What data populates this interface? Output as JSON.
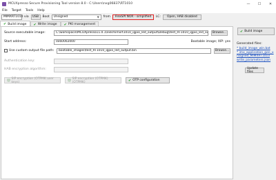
{
  "window": {
    "title": "MCUXpresso Secure Provisioning Tool version 8.0 - C:\\Users\\nxg06837\\RT1010",
    "minimize": "—",
    "maximize": "☐",
    "close": "✕"
  },
  "menu": [
    "File",
    "Target",
    "Tools",
    "Help"
  ],
  "toolbar": {
    "device": "MIMXRT1010",
    "via_label": "via",
    "via_value": "USB",
    "boot_label": "Boot",
    "boot_value": "Unsigned",
    "from_label": "from",
    "memory_value": "FlexSPI NOR - simplified",
    "lc_label": "LC:",
    "lc_value": "Open, HAB disabled"
  },
  "tabs": [
    {
      "label": "Build image"
    },
    {
      "label": "Write image"
    },
    {
      "label": "PKI management"
    }
  ],
  "form": {
    "source_label": "Source executable image:",
    "source_value": "C:\\workspace\\MCUXpresso11.0.1\\evkmimxrt1010_igpio_led_output\\Debug\\test_RT1010_igpio_led_output.bin",
    "browse1": "Browse...",
    "start_label": "Start address:",
    "start_value": "0x60002000",
    "bootable_label": "Bootable image; XIP: yes",
    "custom_label": "Use custom output file path:",
    "custom_value": "bootable_images\\test_RT1010_igpio_led_output.bin",
    "browse2": "Browse...",
    "auth_label": "Authentication key:",
    "hab_label": "HAB encryption algorithm:",
    "btn_sip_user": "SIP encryption (OTPMK user keys)",
    "btn_sip_otpmk": "SIP encryption (OTPMK) (OTPMK)",
    "btn_otp": "OTP configuration"
  },
  "right": {
    "build_button": "Build image",
    "generated_label": "Generated files:",
    "files": [
      "* build_image_win.bat",
      "* imx_application_gen_u",
      "  nsigned_MIMXRT1010",
      "  write_parameters.json"
    ],
    "update_button": "Update files"
  }
}
